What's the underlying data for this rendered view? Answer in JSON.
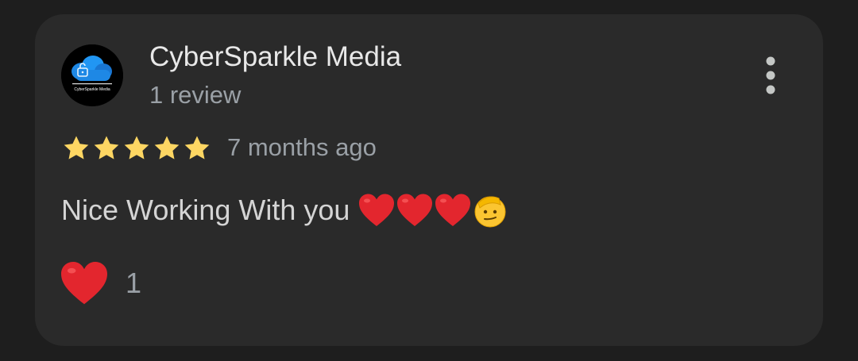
{
  "review": {
    "author_name": "CyberSparkle Media",
    "author_review_count": "1 review",
    "avatar_caption": "CyberSparkle Media",
    "rating": 5,
    "rating_max": 5,
    "time_ago": "7 months ago",
    "text": "Nice Working With you",
    "text_emojis": [
      "heart-emoji",
      "heart-emoji",
      "heart-emoji",
      "saluting-face-emoji"
    ],
    "reaction": {
      "icon": "heart-emoji",
      "count": "1"
    },
    "more_icon": "more-vertical-icon"
  },
  "colors": {
    "background": "#1e1e1e",
    "card": "#2a2a2a",
    "star": "#fdd663",
    "heart": "#e3262e",
    "primary_text": "#e8e8e8",
    "secondary_text": "#9aa0a6"
  }
}
